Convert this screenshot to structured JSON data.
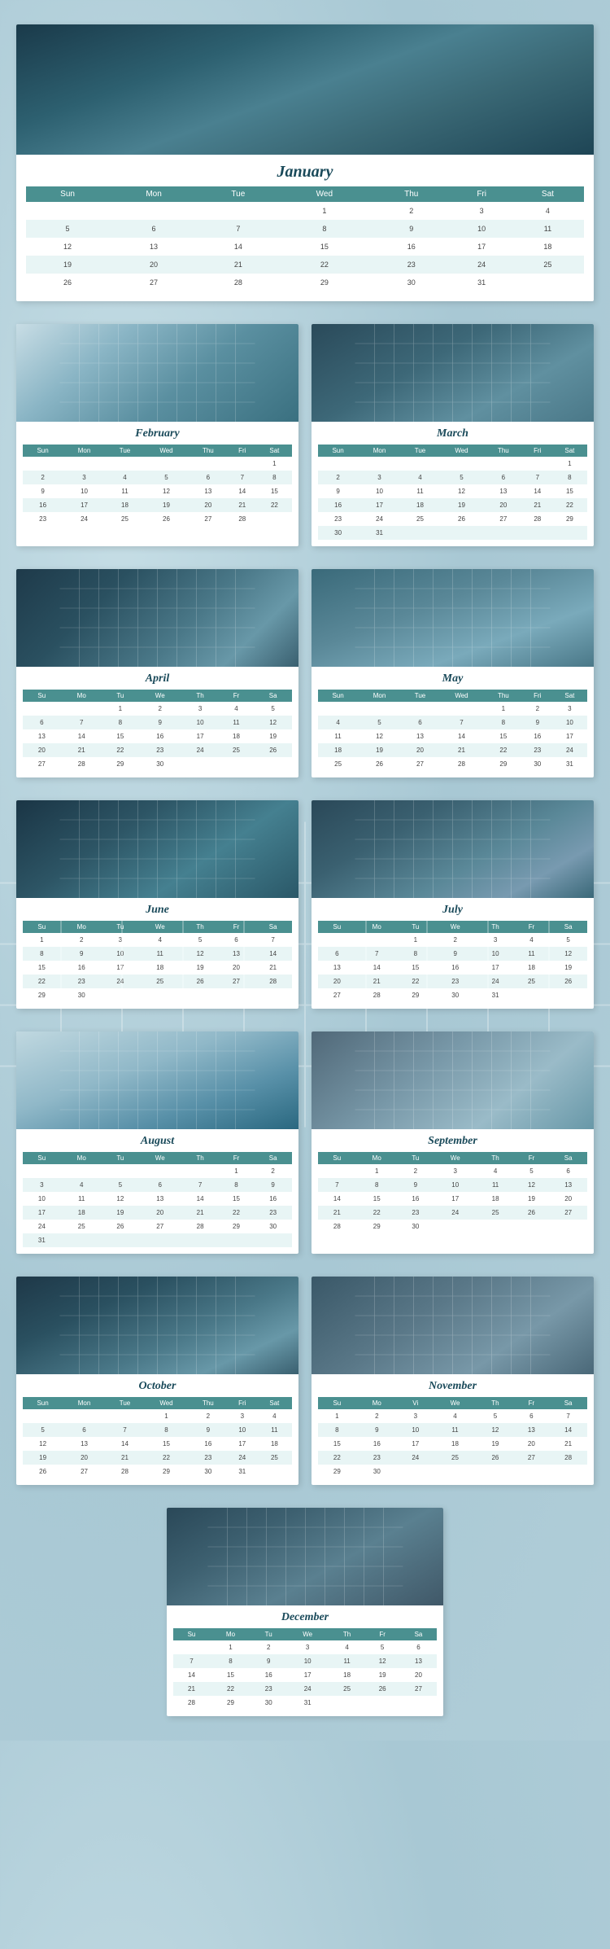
{
  "months": [
    {
      "name": "January",
      "img_class": "img-building-1",
      "full": true,
      "days": [
        "Sun",
        "Mon",
        "Tue",
        "Wed",
        "Thu",
        "Fri",
        "Sat"
      ],
      "weeks": [
        [
          "",
          "",
          "",
          "1",
          "2",
          "3",
          "4"
        ],
        [
          "5",
          "6",
          "7",
          "8",
          "9",
          "10",
          "11"
        ],
        [
          "12",
          "13",
          "14",
          "15",
          "16",
          "17",
          "18"
        ],
        [
          "19",
          "20",
          "21",
          "22",
          "23",
          "24",
          "25"
        ],
        [
          "26",
          "27",
          "28",
          "29",
          "30",
          "31",
          ""
        ]
      ]
    },
    {
      "name": "February",
      "img_class": "img-building-2",
      "full": false,
      "days": [
        "Sun",
        "Mon",
        "Tue",
        "Wed",
        "Thu",
        "Fri",
        "Sat"
      ],
      "weeks": [
        [
          "",
          "",
          "",
          "",
          "",
          "",
          "1"
        ],
        [
          "2",
          "3",
          "4",
          "5",
          "6",
          "7",
          "8"
        ],
        [
          "9",
          "10",
          "11",
          "12",
          "13",
          "14",
          "15"
        ],
        [
          "16",
          "17",
          "18",
          "19",
          "20",
          "21",
          "22"
        ],
        [
          "23",
          "24",
          "25",
          "26",
          "27",
          "28",
          ""
        ]
      ]
    },
    {
      "name": "March",
      "img_class": "img-building-3",
      "full": false,
      "days": [
        "Sun",
        "Mon",
        "Tue",
        "Wed",
        "Thu",
        "Fri",
        "Sat"
      ],
      "weeks": [
        [
          "",
          "",
          "",
          "",
          "",
          "",
          "1"
        ],
        [
          "2",
          "3",
          "4",
          "5",
          "6",
          "7",
          "8"
        ],
        [
          "9",
          "10",
          "11",
          "12",
          "13",
          "14",
          "15"
        ],
        [
          "16",
          "17",
          "18",
          "19",
          "20",
          "21",
          "22"
        ],
        [
          "23",
          "24",
          "25",
          "26",
          "27",
          "28",
          "29"
        ],
        [
          "30",
          "31",
          "",
          "",
          "",
          "",
          ""
        ]
      ]
    },
    {
      "name": "April",
      "img_class": "img-building-4",
      "full": false,
      "days": [
        "Su",
        "Mo",
        "Tu",
        "We",
        "Th",
        "Fr",
        "Sa"
      ],
      "weeks": [
        [
          "",
          "",
          "1",
          "2",
          "3",
          "4",
          "5"
        ],
        [
          "6",
          "7",
          "8",
          "9",
          "10",
          "11",
          "12"
        ],
        [
          "13",
          "14",
          "15",
          "16",
          "17",
          "18",
          "19"
        ],
        [
          "20",
          "21",
          "22",
          "23",
          "24",
          "25",
          "26"
        ],
        [
          "27",
          "28",
          "29",
          "30",
          "",
          "",
          ""
        ]
      ]
    },
    {
      "name": "May",
      "img_class": "img-building-5",
      "full": false,
      "days": [
        "Sun",
        "Mon",
        "Tue",
        "Wed",
        "Thu",
        "Fri",
        "Sat"
      ],
      "weeks": [
        [
          "",
          "",
          "",
          "",
          "1",
          "2",
          "3"
        ],
        [
          "4",
          "5",
          "6",
          "7",
          "8",
          "9",
          "10"
        ],
        [
          "11",
          "12",
          "13",
          "14",
          "15",
          "16",
          "17"
        ],
        [
          "18",
          "19",
          "20",
          "21",
          "22",
          "23",
          "24"
        ],
        [
          "25",
          "26",
          "27",
          "28",
          "29",
          "30",
          "31"
        ]
      ]
    },
    {
      "name": "June",
      "img_class": "img-building-6",
      "full": false,
      "days": [
        "Su",
        "Mo",
        "Tu",
        "We",
        "Th",
        "Fr",
        "Sa"
      ],
      "weeks": [
        [
          "1",
          "2",
          "3",
          "4",
          "5",
          "6",
          "7"
        ],
        [
          "8",
          "9",
          "10",
          "11",
          "12",
          "13",
          "14"
        ],
        [
          "15",
          "16",
          "17",
          "18",
          "19",
          "20",
          "21"
        ],
        [
          "22",
          "23",
          "24",
          "25",
          "26",
          "27",
          "28"
        ],
        [
          "29",
          "30",
          "",
          "",
          "",
          "",
          ""
        ]
      ]
    },
    {
      "name": "July",
      "img_class": "img-building-7",
      "full": false,
      "days": [
        "Su",
        "Mo",
        "Tu",
        "We",
        "Th",
        "Fr",
        "Sa"
      ],
      "weeks": [
        [
          "",
          "",
          "1",
          "2",
          "3",
          "4",
          "5"
        ],
        [
          "6",
          "7",
          "8",
          "9",
          "10",
          "11",
          "12"
        ],
        [
          "13",
          "14",
          "15",
          "16",
          "17",
          "18",
          "19"
        ],
        [
          "20",
          "21",
          "22",
          "23",
          "24",
          "25",
          "26"
        ],
        [
          "27",
          "28",
          "29",
          "30",
          "31",
          "",
          ""
        ]
      ]
    },
    {
      "name": "August",
      "img_class": "img-building-8",
      "full": false,
      "days": [
        "Su",
        "Mo",
        "Tu",
        "We",
        "Th",
        "Fr",
        "Sa"
      ],
      "weeks": [
        [
          "",
          "",
          "",
          "",
          "",
          "1",
          "2"
        ],
        [
          "3",
          "4",
          "5",
          "6",
          "7",
          "8",
          "9"
        ],
        [
          "10",
          "11",
          "12",
          "13",
          "14",
          "15",
          "16"
        ],
        [
          "17",
          "18",
          "19",
          "20",
          "21",
          "22",
          "23"
        ],
        [
          "24",
          "25",
          "26",
          "27",
          "28",
          "29",
          "30"
        ],
        [
          "31",
          "",
          "",
          "",
          "",
          "",
          ""
        ]
      ]
    },
    {
      "name": "September",
      "img_class": "img-building-9",
      "full": false,
      "days": [
        "Su",
        "Mo",
        "Tu",
        "We",
        "Th",
        "Fr",
        "Sa"
      ],
      "weeks": [
        [
          "",
          "1",
          "2",
          "3",
          "4",
          "5",
          "6"
        ],
        [
          "7",
          "8",
          "9",
          "10",
          "11",
          "12",
          "13"
        ],
        [
          "14",
          "15",
          "16",
          "17",
          "18",
          "19",
          "20"
        ],
        [
          "21",
          "22",
          "23",
          "24",
          "25",
          "26",
          "27"
        ],
        [
          "28",
          "29",
          "30",
          "",
          "",
          "",
          ""
        ]
      ]
    },
    {
      "name": "October",
      "img_class": "img-building-10",
      "full": false,
      "days": [
        "Sun",
        "Mon",
        "Tue",
        "Wed",
        "Thu",
        "Fri",
        "Sat"
      ],
      "weeks": [
        [
          "",
          "",
          "",
          "1",
          "2",
          "3",
          "4"
        ],
        [
          "5",
          "6",
          "7",
          "8",
          "9",
          "10",
          "11"
        ],
        [
          "12",
          "13",
          "14",
          "15",
          "16",
          "17",
          "18"
        ],
        [
          "19",
          "20",
          "21",
          "22",
          "23",
          "24",
          "25"
        ],
        [
          "26",
          "27",
          "28",
          "29",
          "30",
          "31",
          ""
        ]
      ]
    },
    {
      "name": "November",
      "img_class": "img-building-11",
      "full": false,
      "days": [
        "Su",
        "Mo",
        "Vi",
        "We",
        "Th",
        "Fr",
        "Sa"
      ],
      "weeks": [
        [
          "1",
          "2",
          "3",
          "4",
          "5",
          "6",
          "7"
        ],
        [
          "8",
          "9",
          "10",
          "11",
          "12",
          "13",
          "14"
        ],
        [
          "15",
          "16",
          "17",
          "18",
          "19",
          "20",
          "21"
        ],
        [
          "22",
          "23",
          "24",
          "25",
          "26",
          "27",
          "28"
        ],
        [
          "29",
          "30",
          "",
          "",
          "",
          "",
          ""
        ]
      ]
    },
    {
      "name": "December",
      "img_class": "img-building-12",
      "full": false,
      "single": true,
      "days": [
        "Su",
        "Mo",
        "Tu",
        "We",
        "Th",
        "Fr",
        "Sa"
      ],
      "weeks": [
        [
          "",
          "1",
          "2",
          "3",
          "4",
          "5",
          "6"
        ],
        [
          "7",
          "8",
          "9",
          "10",
          "11",
          "12",
          "13"
        ],
        [
          "14",
          "15",
          "16",
          "17",
          "18",
          "19",
          "20"
        ],
        [
          "21",
          "22",
          "23",
          "24",
          "25",
          "26",
          "27"
        ],
        [
          "28",
          "29",
          "30",
          "31",
          "",
          "",
          ""
        ]
      ]
    }
  ]
}
